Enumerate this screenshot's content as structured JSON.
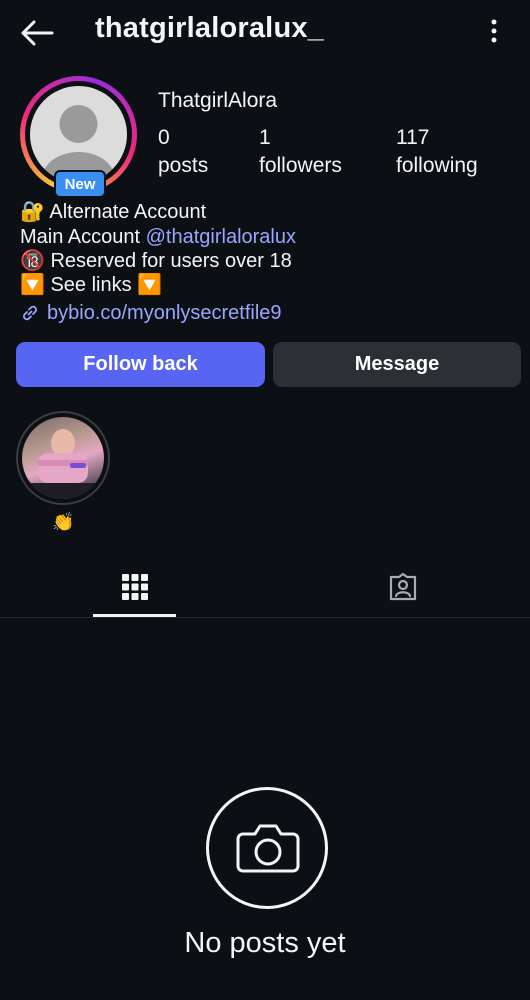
{
  "header": {
    "username": "thatgirlaloralux_"
  },
  "profile": {
    "display_name": "ThatgirlAlora",
    "badge": "New",
    "stats": [
      {
        "value": "0",
        "label": "posts"
      },
      {
        "value": "1",
        "label": "followers"
      },
      {
        "value": "117",
        "label": "following"
      }
    ]
  },
  "bio": {
    "line1_emoji": "🔐",
    "line1": "Alternate Account",
    "line2_prefix": "Main Account ",
    "line2_mention": "@thatgirlaloralux",
    "line3_emoji": "🔞",
    "line3": "Reserved for users over 18",
    "line4_emoji": "🔽",
    "line4": "See links",
    "link": "bybio.co/myonlysecretfile9"
  },
  "actions": {
    "follow_back": "Follow back",
    "message": "Message"
  },
  "highlight": {
    "caption": "👏"
  },
  "empty_state": {
    "text": "No posts yet"
  },
  "colors": {
    "background": "#0c0f14",
    "accent": "#5865f2",
    "link": "#9aa6ff",
    "badge": "#3a8ef0"
  },
  "icons": {
    "back": "back-arrow-icon",
    "more": "more-vertical-icon",
    "grid": "grid-icon",
    "tagged": "tagged-person-icon",
    "camera": "camera-icon",
    "link": "link-icon"
  }
}
